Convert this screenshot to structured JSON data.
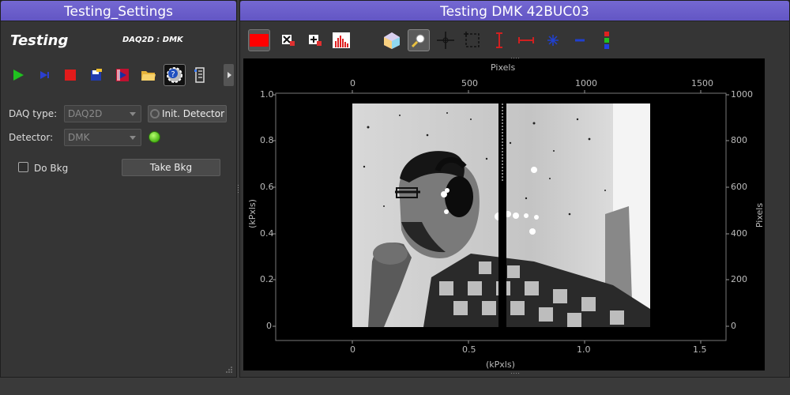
{
  "left_dock": {
    "title": "Testing_Settings",
    "heading": "Testing",
    "subheading": "DAQ2D : DMK",
    "daq_type_label": "DAQ type:",
    "daq_type_value": "DAQ2D",
    "init_detector_label": "Init. Detector",
    "detector_label": "Detector:",
    "detector_value": "DMK",
    "do_bkg_label": "Do Bkg",
    "take_bkg_label": "Take Bkg",
    "toolbar_icons": [
      "play-icon",
      "step-icon",
      "stop-icon",
      "save-icon",
      "record-icon",
      "open-folder-icon",
      "settings-help-icon",
      "log-icon",
      "more-arrow-icon"
    ]
  },
  "right_dock": {
    "title": "Testing DMK 42BUC03",
    "toolbar_icons": [
      "color-red-icon",
      "flip-ud-icon",
      "flip-lr-icon",
      "histogram-icon",
      "colormap-icon",
      "zoom-icon",
      "crosshair-icon",
      "roi-rect-icon",
      "vertical-marker-icon",
      "horizontal-marker-icon",
      "isocurve-icon",
      "line-profile-icon",
      "channels-icon"
    ],
    "plot": {
      "top_axis_label": "Pixels",
      "bottom_axis_label": "(kPxls)",
      "left_axis_label": "(kPxls)",
      "right_axis_label": "Pixels",
      "top_ticks": [
        "0",
        "500",
        "1000",
        "1500"
      ],
      "bottom_ticks": [
        "0",
        "0.5",
        "1.0",
        "1.5"
      ],
      "left_ticks": [
        "1.0",
        "0.8",
        "0.6",
        "0.4",
        "0.2",
        "0"
      ],
      "right_ticks": [
        "1000",
        "800",
        "600",
        "400",
        "200",
        "0"
      ]
    }
  }
}
